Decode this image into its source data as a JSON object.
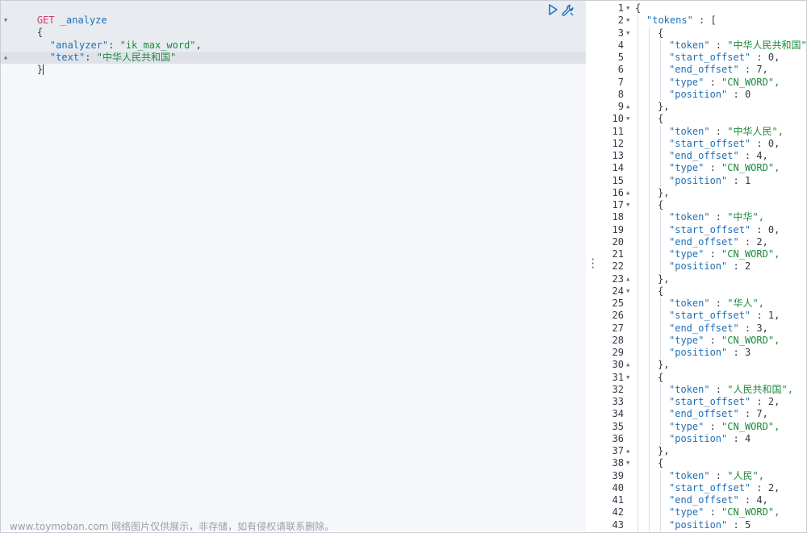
{
  "request": {
    "method": "GET",
    "path": "_analyze",
    "lines": [
      {
        "type": "open",
        "text": "{"
      },
      {
        "type": "kv",
        "key": "\"analyzer\"",
        "sep": ": ",
        "value": "\"ik_max_word\"",
        "tail": ","
      },
      {
        "type": "kv",
        "key": "\"text\"",
        "sep": ": ",
        "value": "\"中华人民共和国\"",
        "tail": ""
      },
      {
        "type": "close",
        "text": "}"
      }
    ],
    "run_icon": "play-icon",
    "settings_icon": "wrench-icon"
  },
  "response": {
    "line_numbers": [
      "1",
      "2",
      "3",
      "4",
      "5",
      "6",
      "7",
      "8",
      "9",
      "10",
      "11",
      "12",
      "13",
      "14",
      "15",
      "16",
      "17",
      "18",
      "19",
      "20",
      "21",
      "22",
      "23",
      "24",
      "25",
      "26",
      "27",
      "28",
      "29",
      "30",
      "31",
      "32",
      "33",
      "34",
      "35",
      "36",
      "37",
      "38",
      "39",
      "40",
      "41",
      "42",
      "43"
    ],
    "lines": [
      {
        "k": "",
        "v": "{",
        "kind": "punc"
      },
      {
        "k": "\"tokens\"",
        "v": " : [",
        "kind": "key"
      },
      {
        "k": "",
        "v": "{",
        "kind": "punc"
      },
      {
        "k": "\"token\"",
        "v": "\"中华人民共和国\"",
        "kind": "str"
      },
      {
        "k": "\"start_offset\"",
        "v": "0,",
        "kind": "num"
      },
      {
        "k": "\"end_offset\"",
        "v": "7,",
        "kind": "num"
      },
      {
        "k": "\"type\"",
        "v": "\"CN_WORD\",",
        "kind": "str"
      },
      {
        "k": "\"position\"",
        "v": "0",
        "kind": "num"
      },
      {
        "k": "",
        "v": "},",
        "kind": "punc"
      },
      {
        "k": "",
        "v": "{",
        "kind": "punc"
      },
      {
        "k": "\"token\"",
        "v": "\"中华人民\",",
        "kind": "str"
      },
      {
        "k": "\"start_offset\"",
        "v": "0,",
        "kind": "num"
      },
      {
        "k": "\"end_offset\"",
        "v": "4,",
        "kind": "num"
      },
      {
        "k": "\"type\"",
        "v": "\"CN_WORD\",",
        "kind": "str"
      },
      {
        "k": "\"position\"",
        "v": "1",
        "kind": "num"
      },
      {
        "k": "",
        "v": "},",
        "kind": "punc"
      },
      {
        "k": "",
        "v": "{",
        "kind": "punc"
      },
      {
        "k": "\"token\"",
        "v": "\"中华\",",
        "kind": "str"
      },
      {
        "k": "\"start_offset\"",
        "v": "0,",
        "kind": "num"
      },
      {
        "k": "\"end_offset\"",
        "v": "2,",
        "kind": "num"
      },
      {
        "k": "\"type\"",
        "v": "\"CN_WORD\",",
        "kind": "str"
      },
      {
        "k": "\"position\"",
        "v": "2",
        "kind": "num"
      },
      {
        "k": "",
        "v": "},",
        "kind": "punc"
      },
      {
        "k": "",
        "v": "{",
        "kind": "punc"
      },
      {
        "k": "\"token\"",
        "v": "\"华人\",",
        "kind": "str"
      },
      {
        "k": "\"start_offset\"",
        "v": "1,",
        "kind": "num"
      },
      {
        "k": "\"end_offset\"",
        "v": "3,",
        "kind": "num"
      },
      {
        "k": "\"type\"",
        "v": "\"CN_WORD\",",
        "kind": "str"
      },
      {
        "k": "\"position\"",
        "v": "3",
        "kind": "num"
      },
      {
        "k": "",
        "v": "},",
        "kind": "punc"
      },
      {
        "k": "",
        "v": "{",
        "kind": "punc"
      },
      {
        "k": "\"token\"",
        "v": "\"人民共和国\",",
        "kind": "str"
      },
      {
        "k": "\"start_offset\"",
        "v": "2,",
        "kind": "num"
      },
      {
        "k": "\"end_offset\"",
        "v": "7,",
        "kind": "num"
      },
      {
        "k": "\"type\"",
        "v": "\"CN_WORD\",",
        "kind": "str"
      },
      {
        "k": "\"position\"",
        "v": "4",
        "kind": "num"
      },
      {
        "k": "",
        "v": "},",
        "kind": "punc"
      },
      {
        "k": "",
        "v": "{",
        "kind": "punc"
      },
      {
        "k": "\"token\"",
        "v": "\"人民\",",
        "kind": "str"
      },
      {
        "k": "\"start_offset\"",
        "v": "2,",
        "kind": "num"
      },
      {
        "k": "\"end_offset\"",
        "v": "4,",
        "kind": "num"
      },
      {
        "k": "\"type\"",
        "v": "\"CN_WORD\",",
        "kind": "str"
      },
      {
        "k": "\"position\"",
        "v": "5",
        "kind": "num"
      }
    ],
    "fold_down_lines": [
      "1",
      "2",
      "3",
      "10",
      "17",
      "24",
      "31",
      "38"
    ],
    "fold_up_lines": [
      "9",
      "16",
      "23",
      "30",
      "37"
    ]
  },
  "watermark": "www.toymoban.com 网络图片仅供展示，非存储，如有侵权请联系删除。",
  "colors": {
    "keyword": "#d6376e",
    "key": "#1f6fb7",
    "string": "#1d8a3a",
    "text": "#343741"
  }
}
